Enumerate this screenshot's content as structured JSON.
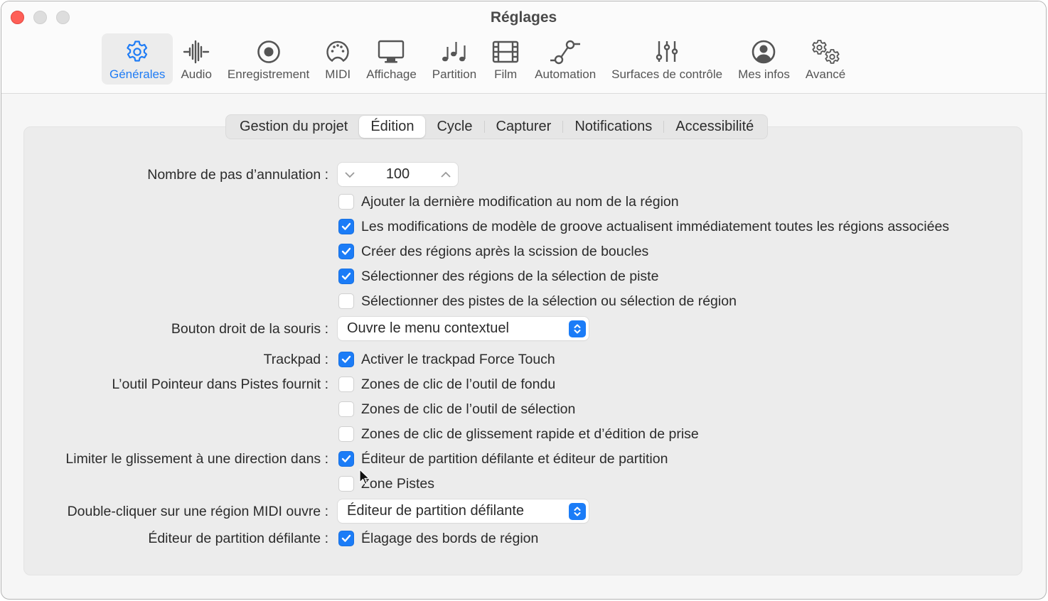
{
  "window": {
    "title": "Réglages",
    "traffic_lights": [
      "close",
      "minimize",
      "zoom"
    ]
  },
  "toolbar": {
    "items": [
      {
        "label": "Générales",
        "icon": "gear-icon",
        "active": true
      },
      {
        "label": "Audio",
        "icon": "waveform-icon",
        "active": false
      },
      {
        "label": "Enregistrement",
        "icon": "record-icon",
        "active": false
      },
      {
        "label": "MIDI",
        "icon": "midi-connector-icon",
        "active": false
      },
      {
        "label": "Affichage",
        "icon": "display-icon",
        "active": false
      },
      {
        "label": "Partition",
        "icon": "music-notes-icon",
        "active": false
      },
      {
        "label": "Film",
        "icon": "film-icon",
        "active": false
      },
      {
        "label": "Automation",
        "icon": "automation-icon",
        "active": false
      },
      {
        "label": "Surfaces de contrôle",
        "icon": "sliders-icon",
        "active": false
      },
      {
        "label": "Mes infos",
        "icon": "person-circle-icon",
        "active": false
      },
      {
        "label": "Avancé",
        "icon": "gears-icon",
        "active": false
      }
    ],
    "accent_color": "#1f7cf5"
  },
  "tabs": {
    "items": [
      {
        "label": "Gestion du projet",
        "active": false
      },
      {
        "label": "Édition",
        "active": true
      },
      {
        "label": "Cycle",
        "active": false
      },
      {
        "label": "Capturer",
        "active": false
      },
      {
        "label": "Notifications",
        "active": false
      },
      {
        "label": "Accessibilité",
        "active": false
      }
    ]
  },
  "settings": {
    "undo_steps": {
      "label": "Nombre de pas d’annulation :",
      "value": "100"
    },
    "region_options": [
      {
        "text": "Ajouter la dernière modification au nom de la région",
        "checked": false
      },
      {
        "text": "Les modifications de modèle de groove actualisent immédiatement toutes les régions associées",
        "checked": true
      },
      {
        "text": "Créer des régions après la scission de boucles",
        "checked": true
      },
      {
        "text": "Sélectionner des régions de la sélection de piste",
        "checked": true
      },
      {
        "text": "Sélectionner des pistes de la sélection ou sélection de région",
        "checked": false
      }
    ],
    "right_click": {
      "label": "Bouton droit de la souris :",
      "value": "Ouvre le menu contextuel"
    },
    "trackpad": {
      "label": "Trackpad :",
      "text": "Activer le trackpad Force Touch",
      "checked": true
    },
    "pointer_tool": {
      "label": "L’outil Pointeur dans Pistes fournit :",
      "options": [
        {
          "text": "Zones de clic de l’outil de fondu",
          "checked": false
        },
        {
          "text": "Zones de clic de l’outil de sélection",
          "checked": false
        },
        {
          "text": "Zones de clic de glissement rapide et d’édition de prise",
          "checked": false
        }
      ]
    },
    "limit_drag": {
      "label": "Limiter le glissement à une direction dans :",
      "options": [
        {
          "text": "Éditeur de partition défilante et éditeur de partition",
          "checked": true
        },
        {
          "text": "Zone Pistes",
          "checked": false
        }
      ]
    },
    "double_click_midi": {
      "label": "Double-cliquer sur une région MIDI ouvre :",
      "value": "Éditeur de partition défilante"
    },
    "piano_roll": {
      "label": "Éditeur de partition défilante :",
      "text": "Élagage des bords de région",
      "checked": true
    }
  },
  "colors": {
    "checkbox_checked": "#1b7cf7",
    "close_button": "#fe5f57"
  }
}
